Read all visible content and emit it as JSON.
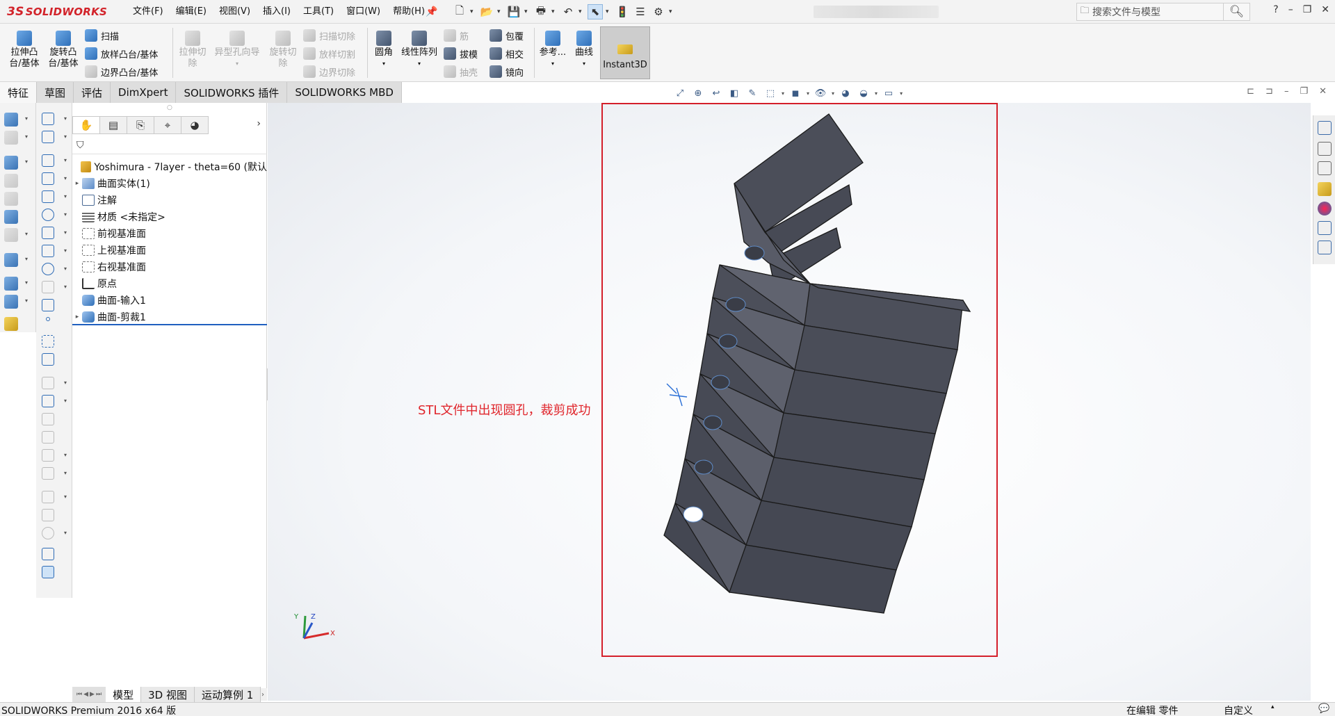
{
  "app": {
    "logo_ds": "3S",
    "logo_solid": "SOLID",
    "logo_works": "WORKS"
  },
  "menu": [
    "文件(F)",
    "编辑(E)",
    "视图(V)",
    "插入(I)",
    "工具(T)",
    "窗口(W)",
    "帮助(H)"
  ],
  "search": {
    "placeholder": "搜索文件与模型"
  },
  "window_controls": {
    "help": "?",
    "minimize": "–",
    "restore": "❐",
    "close": "✕"
  },
  "ribbon": {
    "extrude_boss": "拉伸凸\n台/基体",
    "revolve_boss": "旋转凸\n台/基体",
    "sweep": "扫描",
    "loft_boss": "放样凸台/基体",
    "boundary_boss": "边界凸台/基体",
    "extrude_cut": "拉伸切\n除",
    "hole_wizard": "异型孔向导",
    "revolve_cut": "旋转切\n除",
    "swept_cut": "扫描切除",
    "lofted_cut": "放样切割",
    "boundary_cut": "边界切除",
    "fillet": "圆角",
    "linear_pattern": "线性阵列",
    "rib": "筋",
    "draft": "拔模",
    "shell": "抽壳",
    "wrap": "包覆",
    "intersect": "相交",
    "mirror": "镜向",
    "reference": "参考...",
    "curves": "曲线",
    "instant3d": "Instant3D"
  },
  "tabs": [
    "特征",
    "草图",
    "评估",
    "DimXpert",
    "SOLIDWORKS 插件",
    "SOLIDWORKS MBD"
  ],
  "active_tab": "特征",
  "tree": {
    "root": "Yoshimura - 7layer - theta=60  (默认",
    "items": [
      {
        "label": "曲面实体(1)",
        "expandable": true,
        "icon": "surface-bodies-icon"
      },
      {
        "label": "注解",
        "expandable": false,
        "icon": "annotations-icon"
      },
      {
        "label": "材质 <未指定>",
        "expandable": false,
        "icon": "material-icon"
      },
      {
        "label": "前视基准面",
        "expandable": false,
        "icon": "plane-icon"
      },
      {
        "label": "上视基准面",
        "expandable": false,
        "icon": "plane-icon"
      },
      {
        "label": "右视基准面",
        "expandable": false,
        "icon": "plane-icon"
      },
      {
        "label": "原点",
        "expandable": false,
        "icon": "origin-icon"
      },
      {
        "label": "曲面-输入1",
        "expandable": false,
        "icon": "surface-import-icon"
      },
      {
        "label": "曲面-剪裁1",
        "expandable": true,
        "icon": "surface-trim-icon"
      }
    ]
  },
  "annotation": {
    "text": "STL文件中出现圆孔，裁剪成功",
    "color": "#e0252b"
  },
  "triad": {
    "x": "X",
    "y": "Y",
    "z": "Z"
  },
  "bottom_tabs": [
    "模型",
    "3D 视图",
    "运动算例 1"
  ],
  "active_bottom_tab": "模型",
  "status": {
    "left": "SOLIDWORKS Premium 2016 x64 版",
    "editing": "在编辑 零件",
    "custom": "自定义"
  },
  "colors": {
    "accent": "#1f5fbf",
    "annotation_red": "#d41f2a",
    "model_fill": "#4a4d58"
  }
}
